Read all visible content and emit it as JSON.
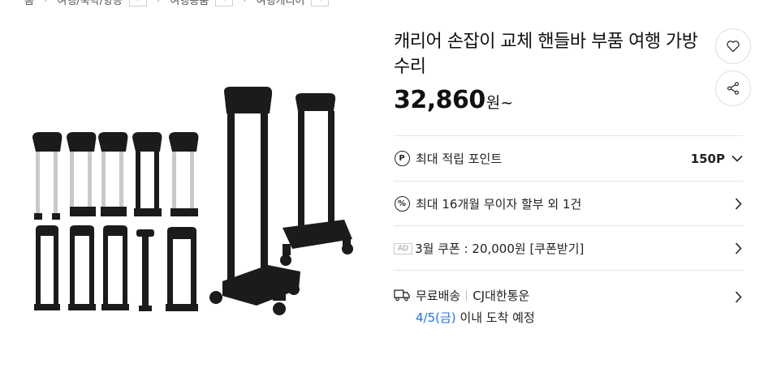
{
  "breadcrumb": [
    {
      "label": "홈"
    },
    {
      "label": "여행/숙박/항공"
    },
    {
      "label": "여행용품"
    },
    {
      "label": "여행캐리어"
    }
  ],
  "product": {
    "title": "캐리어 손잡이 교체 핸들바 부품 여행 가방 수리",
    "price": "32,860",
    "price_unit": "원~"
  },
  "points": {
    "label": "최대 적립 포인트",
    "value": "150P",
    "icon": "P"
  },
  "installment": {
    "label": "최대 16개월 무이자 할부 외 1건",
    "icon": "%"
  },
  "coupon": {
    "badge": "AD",
    "label": "3월 쿠폰 : 20,000원 [쿠폰받기]"
  },
  "shipping": {
    "type": "무료배송",
    "carrier": "CJ대한통운",
    "date": "4/5(금)",
    "arrival": "이내 도착 예정"
  },
  "icons": {
    "favorite": "heart-icon",
    "share": "share-icon",
    "truck": "truck-icon",
    "chevron": "chevron-right-icon"
  },
  "colors": {
    "accent_blue": "#1a73e8",
    "handle_black": "#1b1b1b",
    "tube_silver": "#c9c9c9"
  }
}
